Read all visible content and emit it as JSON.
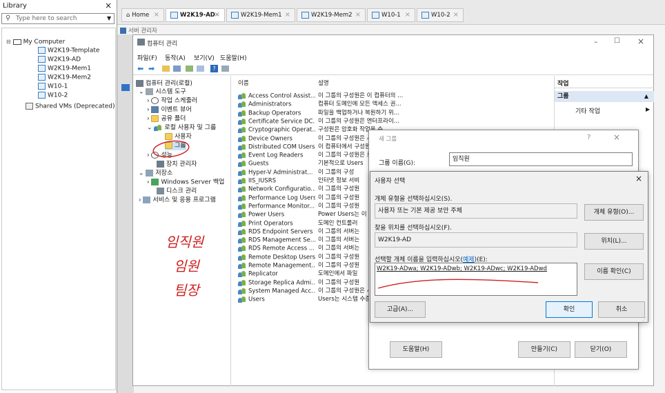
{
  "library": {
    "title": "Library",
    "search_placeholder": "Type here to search",
    "root": "My Computer",
    "items": [
      "W2K19-Template",
      "W2K19-AD",
      "W2K19-Mem1",
      "W2K19-Mem2",
      "W10-1",
      "W10-2"
    ],
    "shared": "Shared VMs (Deprecated)"
  },
  "tabs": [
    {
      "label": "Home"
    },
    {
      "label": "W2K19-AD"
    },
    {
      "label": "W2K19-Mem1"
    },
    {
      "label": "W2K19-Mem2"
    },
    {
      "label": "W10-1"
    },
    {
      "label": "W10-2"
    }
  ],
  "server_manager_label": "서버 관리자",
  "mmc": {
    "title": "컴퓨터 관리",
    "menu": [
      "파일(F)",
      "동작(A)",
      "보기(V)",
      "도움말(H)"
    ],
    "tree": {
      "root": "컴퓨터 관리(로컬)",
      "system_tools": "시스템 도구",
      "task_scheduler": "작업 스케줄러",
      "event_viewer": "이벤트 뷰어",
      "shared_folders": "공유 폴더",
      "local_users": "로컬 사용자 및 그룹",
      "users": "사용자",
      "groups": "그룹",
      "performance": "성능",
      "device_manager": "장치 관리자",
      "storage": "저장소",
      "wsb": "Windows Server 백업",
      "disk_mgmt": "디스크 관리",
      "services": "서비스 및 응용 프로그램"
    },
    "list_headers": {
      "name": "이름",
      "desc": "설명"
    },
    "groups": [
      {
        "name": "Access Control Assist...",
        "desc": "이 그룹의 구성원은 이 컴퓨터의 ..."
      },
      {
        "name": "Administrators",
        "desc": "컴퓨터 도메인에 모든 액세스 권..."
      },
      {
        "name": "Backup Operators",
        "desc": "파일을 백업하거나 복원하기 위..."
      },
      {
        "name": "Certificate Service DC...",
        "desc": "이 그룹의 구성원은 엔터프라이..."
      },
      {
        "name": "Cryptographic Operat...",
        "desc": "구성원은 암호화 작업을 수"
      },
      {
        "name": "Device Owners",
        "desc": "이 그룹의 구성원은 시스"
      },
      {
        "name": "Distributed COM Users",
        "desc": "이 컴퓨터에서 구성원이 D"
      },
      {
        "name": "Event Log Readers",
        "desc": "이 그룹의 구성원은 로컬"
      },
      {
        "name": "Guests",
        "desc": "기본적으로 Users"
      },
      {
        "name": "Hyper-V Administrat...",
        "desc": "이 그룹의 구성"
      },
      {
        "name": "IIS_IUSRS",
        "desc": "인터넷 정보 서비"
      },
      {
        "name": "Network Configuratio...",
        "desc": "이 그룹의 구성원"
      },
      {
        "name": "Performance Log Users",
        "desc": "이 그룹의 구성원"
      },
      {
        "name": "Performance Monitor...",
        "desc": "이 그룹의 구성원"
      },
      {
        "name": "Power Users",
        "desc": "Power Users는 이"
      },
      {
        "name": "Print Operators",
        "desc": "도메인 컨트롤러"
      },
      {
        "name": "RDS Endpoint Servers",
        "desc": "이 그룹의 서버는"
      },
      {
        "name": "RDS Management Se...",
        "desc": "이 그룹의 서버는"
      },
      {
        "name": "RDS Remote Access ...",
        "desc": "이 그룹의 서버는"
      },
      {
        "name": "Remote Desktop Users",
        "desc": "이 그룹의 구성원"
      },
      {
        "name": "Remote Management...",
        "desc": "이 그룹의 구성원"
      },
      {
        "name": "Replicator",
        "desc": "도메인에서 파일"
      },
      {
        "name": "Storage Replica Admi...",
        "desc": "이 그룹의 구성원"
      },
      {
        "name": "System Managed Acc...",
        "desc": "이 그룹의 구성원은 시스"
      },
      {
        "name": "Users",
        "desc": "Users는 시스템 수준 변경"
      }
    ],
    "actions": {
      "header": "작업",
      "section": "그룹",
      "other": "기타 작업"
    }
  },
  "new_group": {
    "title": "새 그룹",
    "help": "?",
    "group_name_label": "그룹 이름(G):",
    "group_name_value": "임직원",
    "help_button": "도움말(H)",
    "create_button": "만들기(C)",
    "close_button": "닫기(O)"
  },
  "select_users": {
    "title": "사용자 선택",
    "object_type_label": "개체 유형을 선택하십시오(S).",
    "object_type_value": "사용자 또는 기본 제공 보안 주체",
    "object_type_button": "개체 유형(O)...",
    "location_label": "찾을 위치를 선택하십시오(F).",
    "location_value": "W2K19-AD",
    "location_button": "위치(L)...",
    "names_label_prefix": "선택할 개체 이름을 입력하십시오(",
    "names_label_link": "예제",
    "names_label_suffix": ")(E):",
    "names_value": "W2K19-ADwa; W2K19-ADwb; W2K19-ADwc; W2K19-ADwd",
    "check_names_button": "이름 확인(C)",
    "advanced_button": "고급(A)...",
    "ok_button": "확인",
    "cancel_button": "취소"
  },
  "handwriting": [
    "임직원",
    "임원",
    "팀장"
  ],
  "colors": {
    "accent": "#0078d7",
    "annotation": "#d02020",
    "selection": "#cce4f7"
  }
}
